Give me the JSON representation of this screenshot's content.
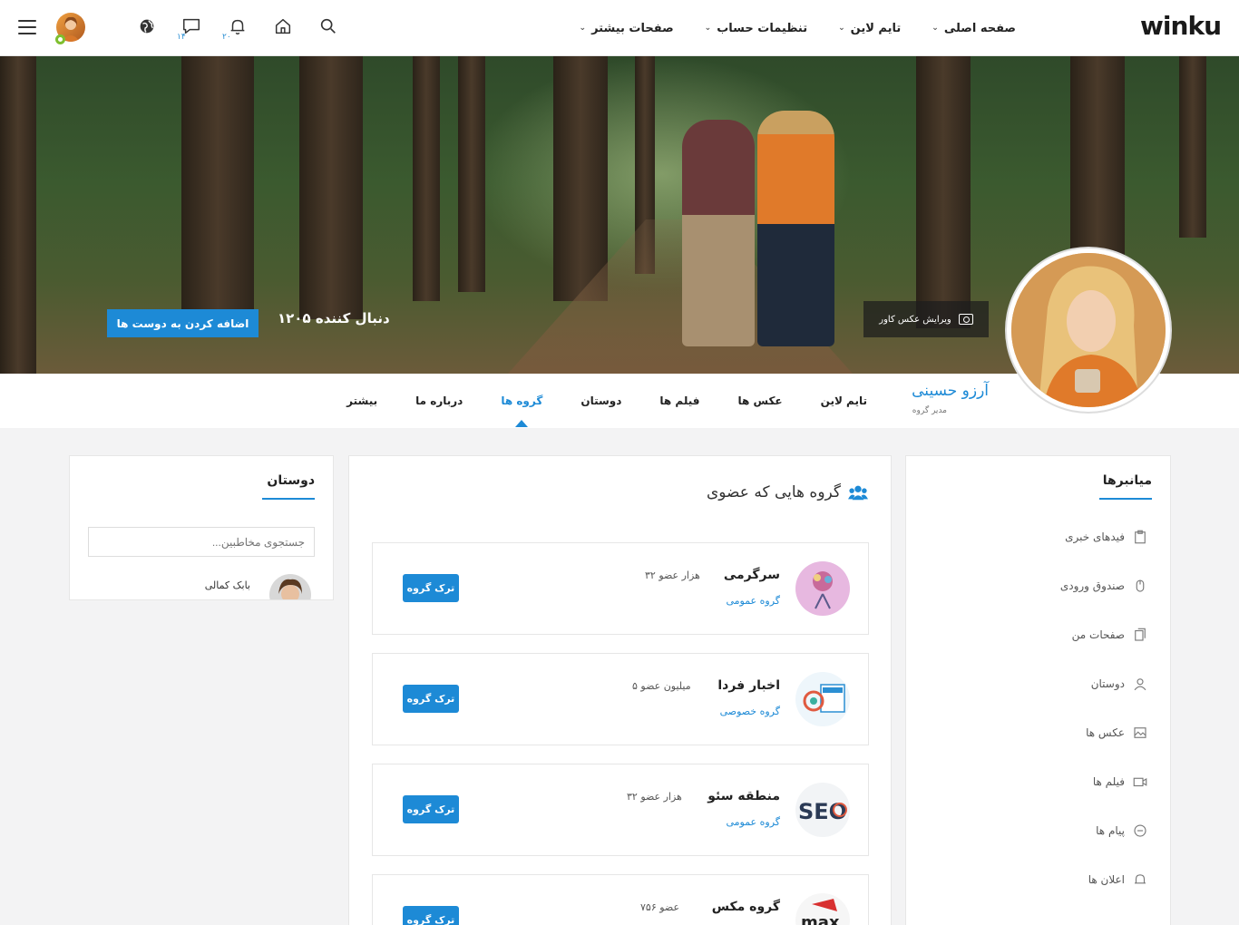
{
  "topbar": {
    "logo": "winku",
    "nav": [
      {
        "label": "صفحه اصلی"
      },
      {
        "label": "تایم لاین"
      },
      {
        "label": "تنظیمات حساب"
      },
      {
        "label": "صفحات بیشتر"
      }
    ],
    "messages_count": "۱۴",
    "notifications_count": "۲۰"
  },
  "cover": {
    "edit_label": "ویرایش عکس کاور",
    "followers": "۱۲۰۵ دنبال کننده",
    "add_friend_label": "اضافه کردن به دوست ها"
  },
  "profile": {
    "name": "آرزو حسینی",
    "role": "مدیر گروه"
  },
  "tabs": [
    {
      "label": "تایم لاین",
      "active": false
    },
    {
      "label": "عکس ها",
      "active": false
    },
    {
      "label": "فیلم ها",
      "active": false
    },
    {
      "label": "دوستان",
      "active": false
    },
    {
      "label": "گروه ها",
      "active": true
    },
    {
      "label": "درباره ما",
      "active": false
    },
    {
      "label": "بیشتر",
      "active": false
    }
  ],
  "shortcuts": {
    "title": "میانبرها",
    "items": [
      {
        "label": "فیدهای خبری",
        "icon": "clipboard-icon"
      },
      {
        "label": "صندوق ورودی",
        "icon": "mouse-icon"
      },
      {
        "label": "صفحات من",
        "icon": "pages-icon"
      },
      {
        "label": "دوستان",
        "icon": "user-icon"
      },
      {
        "label": "عکس ها",
        "icon": "image-icon"
      },
      {
        "label": "فیلم ها",
        "icon": "video-icon"
      },
      {
        "label": "پیام ها",
        "icon": "chat-icon"
      },
      {
        "label": "اعلان ها",
        "icon": "bell-icon"
      }
    ]
  },
  "groups": {
    "title": "گروه هایی که عضوی",
    "leave_label": "ترک گروه",
    "items": [
      {
        "name": "سرگرمی",
        "type": "گروه عمومی",
        "members": "۳۲ هزار عضو"
      },
      {
        "name": "اخبار فردا",
        "type": "گروه خصوصی",
        "members": "۵ میلیون عضو"
      },
      {
        "name": "منطقه سئو",
        "type": "گروه عمومی",
        "members": "۳۲ هزار عضو"
      },
      {
        "name": "گروه مکس",
        "type": "",
        "members": "۷۵۶ عضو"
      }
    ]
  },
  "friends": {
    "title": "دوستان",
    "search_placeholder": "جستجوی مخاطبین...",
    "items": [
      {
        "name": "بابک کمالی"
      }
    ]
  }
}
